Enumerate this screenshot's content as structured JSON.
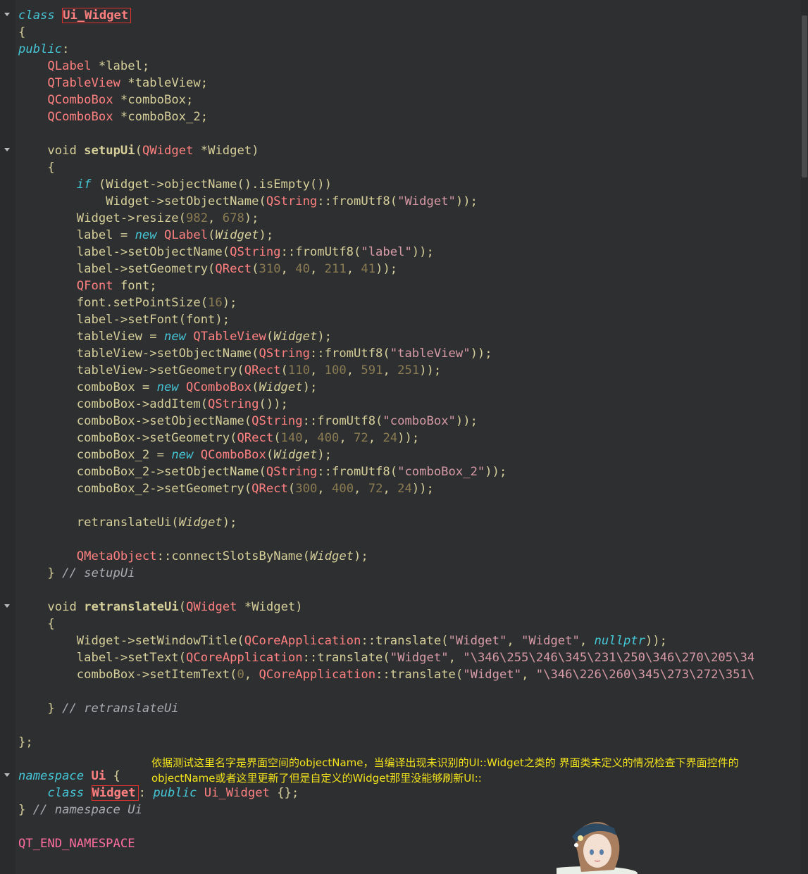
{
  "editor": {
    "line_1_kw": "class",
    "line_1_prefix": "Ui_",
    "line_1_class": "Widget",
    "brace_open": "{",
    "public_label": "public",
    "members": [
      {
        "type": "QLabel",
        "rest": " *label;"
      },
      {
        "type": "QTableView",
        "rest": " *tableView;"
      },
      {
        "type": "QComboBox",
        "rest": " *comboBox;"
      },
      {
        "type": "QComboBox",
        "rest": " *comboBox_2;"
      }
    ],
    "setupUi_sig": {
      "void": "void",
      "name": "setupUi",
      "ptype": "QWidget",
      "param": " *Widget)"
    },
    "retranslate_sig": {
      "void": "void",
      "name": "retranslateUi",
      "ptype": "QWidget",
      "param": " *Widget)"
    },
    "comment_setup": "// setupUi",
    "comment_retranslate": "// retranslateUi",
    "class_end": "};",
    "ns_kw": "namespace",
    "ns_name": "Ui",
    "ns_class_kw": "class",
    "ns_class_name": "Widget",
    "ns_public": "public",
    "ns_base": "Ui_Widget",
    "ns_end_comment": "// namespace Ui",
    "qt_end": "QT_END_NAMESPACE"
  },
  "annotation": {
    "line1": "依据测试这里名字是界面空间的objectName，当编译出现未识别的UI::Widget之类的 界面类未定义的情况检查下界面控件的",
    "line2": "objectName或者这里更新了但是自定义的Widget那里没能够刷新UI::"
  },
  "colors": {
    "background": "#2e2f30",
    "keyword": "#45c6d6",
    "type": "#ff8080",
    "string": "#d69aa7",
    "number": "#8a7b52",
    "plain": "#d6cf9a",
    "annotation": "#f2e21c",
    "highlight_border": "#e0312f"
  }
}
